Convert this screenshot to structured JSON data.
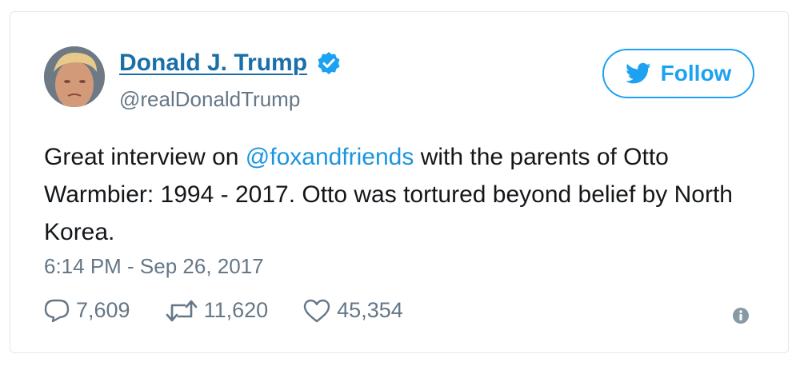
{
  "tweet": {
    "author": {
      "name": "Donald J. Trump",
      "handle": "@realDonaldTrump",
      "verified": true
    },
    "follow_label": "Follow",
    "text_before": "Great interview on ",
    "mention": "@foxandfriends",
    "text_after": " with the parents of Otto Warmbier: 1994 - 2017. Otto was tortured beyond belief by North Korea.",
    "timestamp": "6:14 PM - Sep 26, 2017",
    "stats": {
      "replies": "7,609",
      "retweets": "11,620",
      "likes": "45,354"
    }
  },
  "icons": {
    "verified": "verified-badge-icon",
    "follow": "twitter-bird-icon",
    "reply": "reply-bubble-icon",
    "retweet": "retweet-icon",
    "like": "heart-icon",
    "info": "info-icon"
  },
  "colors": {
    "name": "#1b6fa8",
    "accent": "#1da1f2",
    "mention": "#1b95e0",
    "secondary_text": "#657786",
    "border": "#e1e8ed"
  }
}
